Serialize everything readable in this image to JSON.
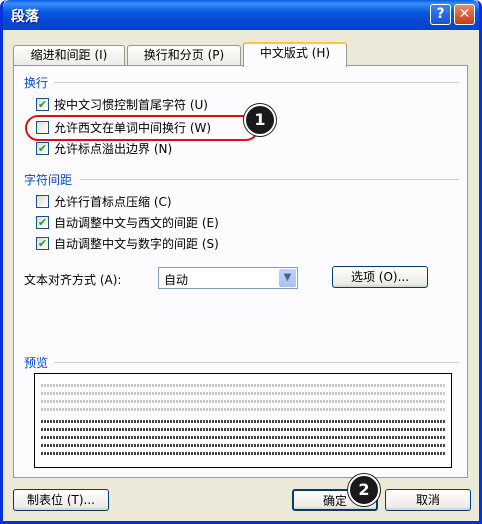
{
  "window": {
    "title": "段落",
    "help_label": "?",
    "close_label": "✕"
  },
  "tabs": [
    {
      "label": "缩进和间距 (I)"
    },
    {
      "label": "换行和分页 (P)"
    },
    {
      "label": "中文版式 (H)",
      "active": true
    }
  ],
  "line_break": {
    "title": "换行",
    "options": [
      {
        "label": "按中文习惯控制首尾字符 (U)",
        "checked": true
      },
      {
        "label": "允许西文在单词中间换行 (W)",
        "checked": false
      },
      {
        "label": "允许标点溢出边界 (N)",
        "checked": true
      }
    ]
  },
  "char_spacing": {
    "title": "字符间距",
    "options": [
      {
        "label": "允许行首标点压缩 (C)",
        "checked": false
      },
      {
        "label": "自动调整中文与西文的间距 (E)",
        "checked": true
      },
      {
        "label": "自动调整中文与数字的间距 (S)",
        "checked": true
      }
    ]
  },
  "text_alignment": {
    "label": "文本对齐方式 (A):",
    "value": "自动"
  },
  "options_button": {
    "label": "选项 (O)..."
  },
  "preview": {
    "title": "预览"
  },
  "footer": {
    "tabstops_label": "制表位 (T)...",
    "ok_label": "确定",
    "cancel_label": "取消"
  },
  "annotations": {
    "badge_1": "1",
    "badge_2": "2"
  },
  "colors": {
    "titlebar": "#0558d8",
    "highlight": "#e01010",
    "group_title": "#0046d5",
    "check": "#21a121"
  }
}
